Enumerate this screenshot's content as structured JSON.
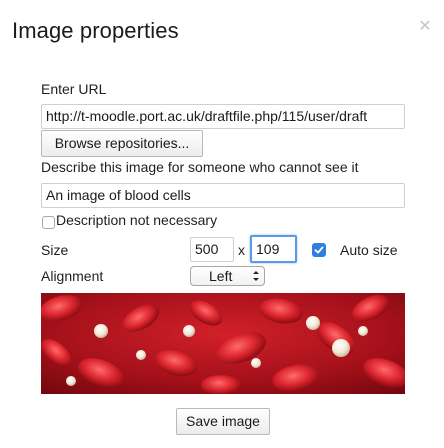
{
  "dialog": {
    "title": "Image properties",
    "close_icon": "close-icon"
  },
  "url": {
    "label": "Enter URL",
    "value": "http://t-moodle.port.ac.uk/draftfile.php/115/user/draft",
    "browse_label": "Browse repositories..."
  },
  "description": {
    "label": "Describe this image for someone who cannot see it",
    "value": "An image of blood cells",
    "not_necessary_label": "Description not necessary",
    "not_necessary_checked": false
  },
  "size": {
    "label": "Size",
    "width": "500",
    "separator": "x",
    "height": "109",
    "auto_size_label": "Auto size",
    "auto_size_checked": true
  },
  "alignment": {
    "label": "Alignment",
    "selected": "Left"
  },
  "footer": {
    "save_label": "Save image"
  },
  "colors": {
    "accent": "#2f7fe0",
    "focus": "#5b9be6",
    "preview_bg": "#9c0d12"
  }
}
